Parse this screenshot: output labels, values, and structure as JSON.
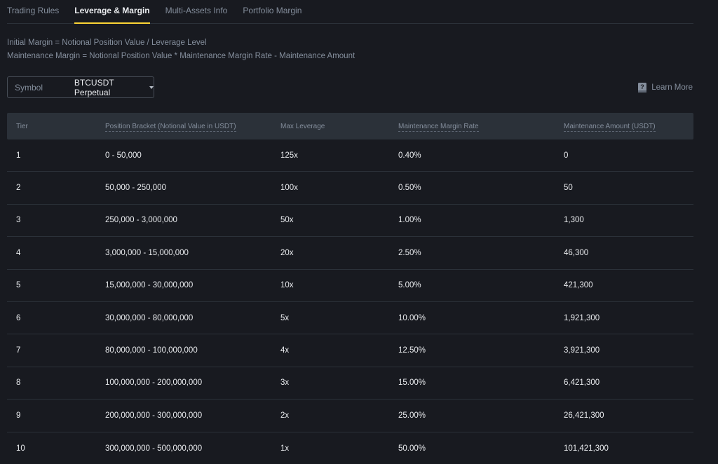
{
  "tabs": [
    {
      "label": "Trading Rules",
      "active": false
    },
    {
      "label": "Leverage & Margin",
      "active": true
    },
    {
      "label": "Multi-Assets Info",
      "active": false
    },
    {
      "label": "Portfolio Margin",
      "active": false
    }
  ],
  "formulas": {
    "initial": "Initial Margin = Notional Position Value / Leverage Level",
    "maintenance": "Maintenance Margin = Notional Position Value * Maintenance Margin Rate - Maintenance Amount"
  },
  "symbol_select": {
    "label": "Symbol",
    "value": "BTCUSDT Perpetual",
    "icon": "chevron-down-icon"
  },
  "learn_more": {
    "label": "Learn More",
    "icon": "help-book-icon"
  },
  "colors": {
    "background": "#181a20",
    "header_bg": "#2b3139",
    "accent": "#fcd535",
    "muted_text": "#848e9c",
    "primary_text": "#eaecef"
  },
  "table": {
    "headers": {
      "tier": "Tier",
      "bracket": "Position Bracket (Notional Value in USDT)",
      "leverage": "Max Leverage",
      "mmr": "Maintenance Margin Rate",
      "amount": "Maintenance Amount (USDT)"
    },
    "rows": [
      {
        "tier": "1",
        "bracket": "0 - 50,000",
        "leverage": "125x",
        "mmr": "0.40%",
        "amount": "0"
      },
      {
        "tier": "2",
        "bracket": "50,000 - 250,000",
        "leverage": "100x",
        "mmr": "0.50%",
        "amount": "50"
      },
      {
        "tier": "3",
        "bracket": "250,000 - 3,000,000",
        "leverage": "50x",
        "mmr": "1.00%",
        "amount": "1,300"
      },
      {
        "tier": "4",
        "bracket": "3,000,000 - 15,000,000",
        "leverage": "20x",
        "mmr": "2.50%",
        "amount": "46,300"
      },
      {
        "tier": "5",
        "bracket": "15,000,000 - 30,000,000",
        "leverage": "10x",
        "mmr": "5.00%",
        "amount": "421,300"
      },
      {
        "tier": "6",
        "bracket": "30,000,000 - 80,000,000",
        "leverage": "5x",
        "mmr": "10.00%",
        "amount": "1,921,300"
      },
      {
        "tier": "7",
        "bracket": "80,000,000 - 100,000,000",
        "leverage": "4x",
        "mmr": "12.50%",
        "amount": "3,921,300"
      },
      {
        "tier": "8",
        "bracket": "100,000,000 - 200,000,000",
        "leverage": "3x",
        "mmr": "15.00%",
        "amount": "6,421,300"
      },
      {
        "tier": "9",
        "bracket": "200,000,000 - 300,000,000",
        "leverage": "2x",
        "mmr": "25.00%",
        "amount": "26,421,300"
      },
      {
        "tier": "10",
        "bracket": "300,000,000 - 500,000,000",
        "leverage": "1x",
        "mmr": "50.00%",
        "amount": "101,421,300"
      }
    ]
  }
}
